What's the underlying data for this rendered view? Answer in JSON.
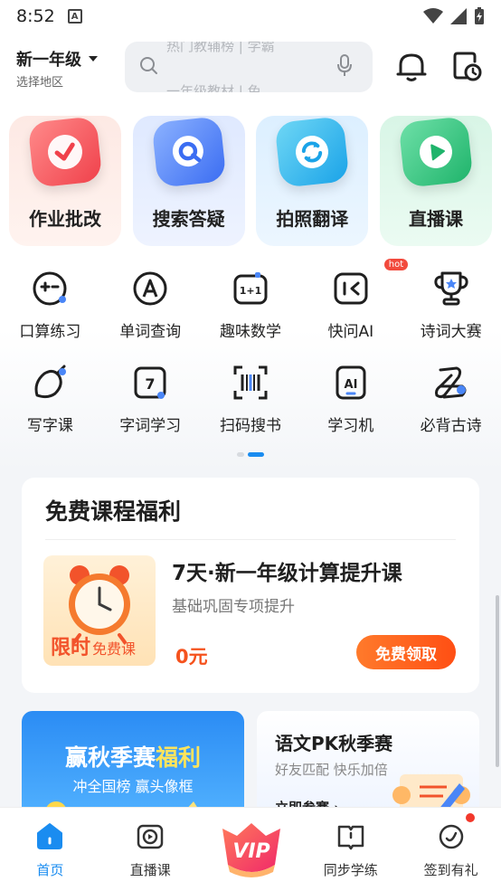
{
  "status_bar": {
    "time": "8:52",
    "notification_letter": "A"
  },
  "header": {
    "grade": "新一年级",
    "region": "选择地区",
    "search_hint_top": "热门教辅榜 | 学霸",
    "search_hint_bottom": "一年级教材 | 免"
  },
  "big_features": [
    {
      "label": "作业批改",
      "icon": "check-icon"
    },
    {
      "label": "搜索答疑",
      "icon": "search-q-icon"
    },
    {
      "label": "拍照翻译",
      "icon": "refresh-icon"
    },
    {
      "label": "直播课",
      "icon": "play-icon"
    }
  ],
  "grid_items": [
    {
      "label": "口算练习"
    },
    {
      "label": "单词查询"
    },
    {
      "label": "趣味数学",
      "icon_text": "1+1"
    },
    {
      "label": "快问AI",
      "badge": "hot"
    },
    {
      "label": "诗词大赛"
    },
    {
      "label": "写字课"
    },
    {
      "label": "字词学习",
      "icon_text": "7"
    },
    {
      "label": "扫码搜书"
    },
    {
      "label": "学习机",
      "icon_text": "AI"
    },
    {
      "label": "必背古诗"
    }
  ],
  "pager": {
    "pages": 2,
    "active": 2
  },
  "course_card": {
    "title": "免费课程福利",
    "thumb_big": "限时",
    "thumb_small": "免费课",
    "name": "7天·新一年级计算提升课",
    "subtitle": "基础巩固专项提升",
    "price": "0元",
    "button": "免费领取"
  },
  "promo_left": {
    "title_main": "赢秋季赛",
    "title_accent": "福利",
    "subtitle": "冲全国榜 赢头像框"
  },
  "promo_right": {
    "title": "语文PK秋季赛",
    "subtitle": "好友匹配 快乐加倍",
    "link": "立即参赛 ›"
  },
  "bottom_nav": [
    {
      "label": "首页",
      "active": true
    },
    {
      "label": "直播课"
    },
    {
      "label": "VIP"
    },
    {
      "label": "同步学练"
    },
    {
      "label": "签到有礼",
      "dot": true
    }
  ],
  "colors": {
    "accent": "#1a8cf0",
    "orange": "#ff5a1a",
    "hot": "#f24a3d"
  }
}
